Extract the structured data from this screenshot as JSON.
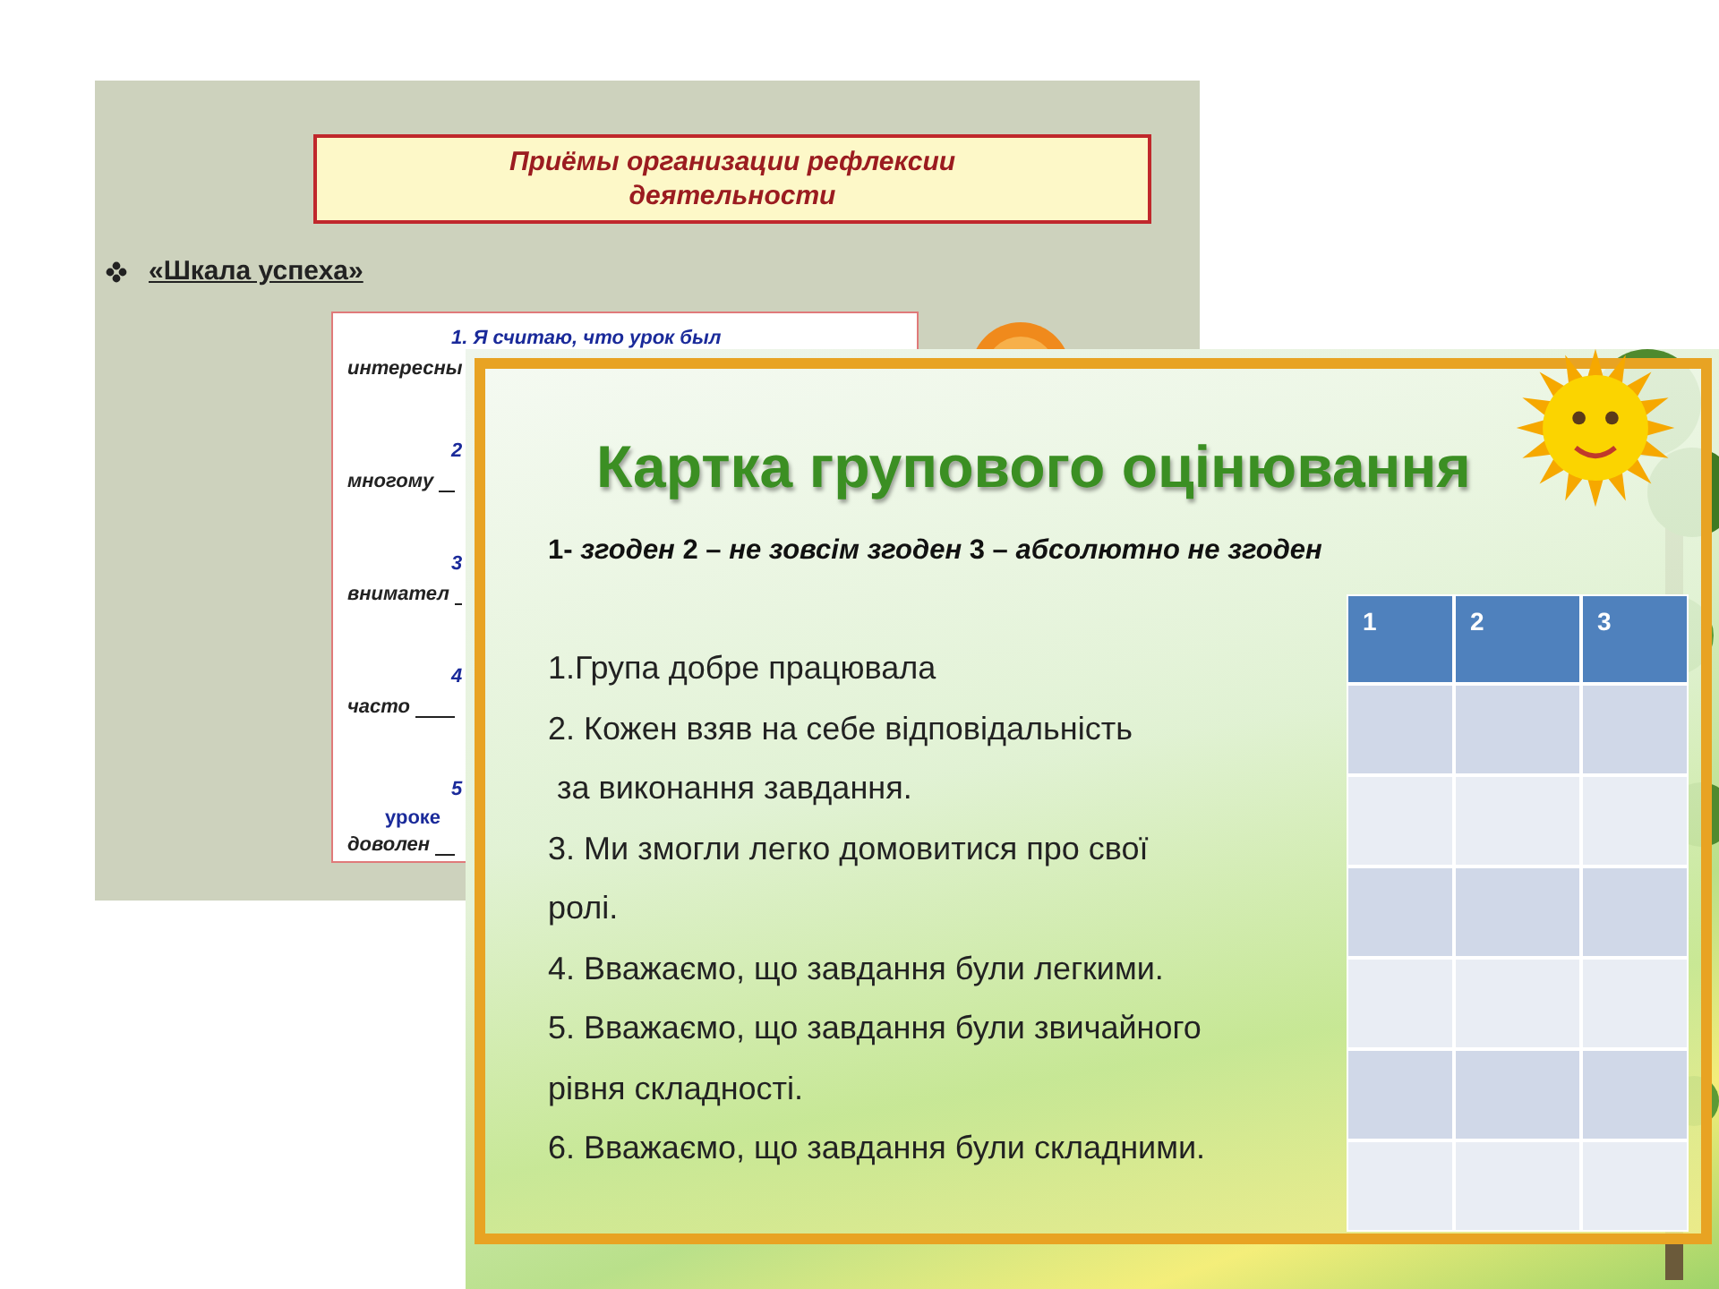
{
  "back_slide": {
    "title": "Приёмы организации  рефлексии деятельности",
    "bullet": "«Шкала успеха»",
    "card_lines": [
      {
        "kind": "heading",
        "text": "1. Я считаю, что урок был"
      },
      {
        "kind": "answer",
        "text": "интересны"
      },
      {
        "kind": "heading",
        "text": "2"
      },
      {
        "kind": "answer",
        "text": "многому"
      },
      {
        "kind": "heading",
        "text": "3"
      },
      {
        "kind": "answer",
        "text": "внимател"
      },
      {
        "kind": "heading",
        "text": "4"
      },
      {
        "kind": "answer",
        "text": "часто"
      },
      {
        "kind": "heading",
        "text": "5"
      },
      {
        "kind": "sub",
        "text": "уроке"
      },
      {
        "kind": "answer",
        "text": "доволен"
      }
    ]
  },
  "front_slide": {
    "title": "Картка групового оцінювання",
    "legend": "1- *згоден*  2 – *не зовсім згоден* 3 – *абсолютно не згоден*",
    "statements": [
      "1.Група добре працювала",
      "2. Кожен взяв на себе відповідальність",
      " за виконання завдання.",
      "3. Ми змогли легко домовитися про свої",
      "ролі.",
      "4. Вважаємо, що завдання були легкими.",
      "5. Вважаємо, що завдання були звичайного",
      "рівня складності.",
      "6. Вважаємо, що завдання були складними."
    ],
    "table": {
      "columns": [
        "1",
        "2",
        "3"
      ],
      "rows": [
        {
          "shaded": true
        },
        {
          "shaded": false
        },
        {
          "shaded": true
        },
        {
          "shaded": false
        },
        {
          "shaded": true
        },
        {
          "shaded": false
        }
      ]
    }
  }
}
